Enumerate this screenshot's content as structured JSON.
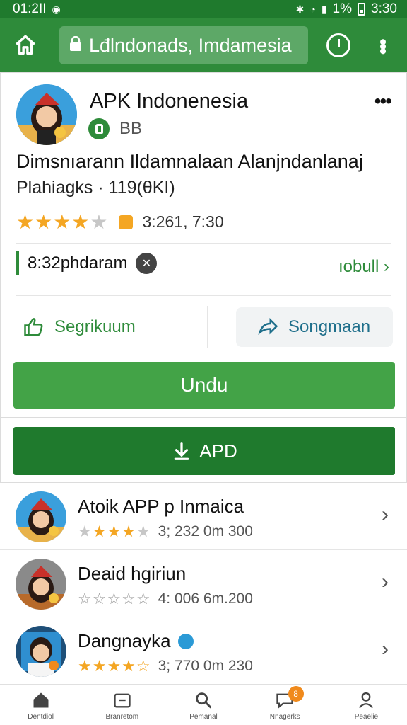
{
  "status": {
    "time": "01:2II",
    "battery": "1%",
    "clock_right": "3:30"
  },
  "appbar": {
    "url": "Lđlndonads, Imdamesia"
  },
  "app": {
    "title": "APK Indonenesia",
    "badge": "BB",
    "desc_line1": "Dimsnıarann Ildamnalaan  Alanjndanlanaj",
    "desc_line2": "Plahiagks · 119(θKI)",
    "rating_text": "3:261, 7:30",
    "stars_full": 4,
    "stars_half": 0.5
  },
  "promo": {
    "text": "8:32phdaram",
    "link": "ıobull"
  },
  "actions": {
    "secondary1": "Segrikuum",
    "secondary2": "Songmaan"
  },
  "buttons": {
    "primary": "Undu",
    "apd": "APD"
  },
  "list": [
    {
      "name": "Atoik APP p Inmaica",
      "info": "3; 232 0m 300",
      "stars": 4
    },
    {
      "name": "Deaid hgiriun",
      "info": "4: 006 6m.200",
      "stars": 0
    },
    {
      "name": "Dangnayka",
      "info": "3; 770 0m 230",
      "stars": 4.5
    }
  ],
  "nav": {
    "items": [
      {
        "label": "Dentdiol"
      },
      {
        "label": "Branretom"
      },
      {
        "label": "Pemanal"
      },
      {
        "label": "Nnagerks",
        "badge": "8"
      },
      {
        "label": "Peaelie"
      }
    ]
  },
  "colors": {
    "brand_green": "#2e8b3a",
    "dark_green": "#1f7a2d",
    "star": "#f4a623"
  }
}
